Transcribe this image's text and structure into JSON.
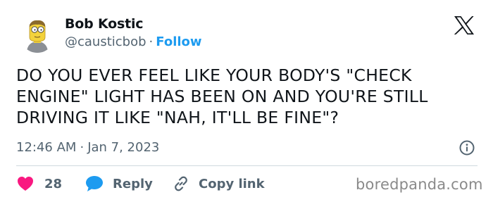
{
  "author": {
    "name": "Bob Kostic",
    "handle": "@causticbob",
    "separator": "·",
    "follow_label": "Follow"
  },
  "tweet": {
    "text": "DO YOU EVER FEEL LIKE YOUR BODY'S \"CHECK ENGINE\" LIGHT HAS BEEN ON AND YOU'RE STILL DRIVING IT LIKE \"NAH, IT'LL BE FINE\"?",
    "time": "12:46 AM",
    "separator": "·",
    "date": "Jan 7, 2023"
  },
  "actions": {
    "like_count": "28",
    "reply_label": "Reply",
    "copy_label": "Copy link"
  },
  "icons": {
    "brand": "x-logo-icon",
    "info": "info-icon",
    "like": "heart-icon",
    "reply": "speech-bubble-icon",
    "copy": "link-icon"
  },
  "colors": {
    "accent": "#1d9bf0",
    "like": "#f91880",
    "text": "#0f1419",
    "muted": "#536471"
  },
  "watermark": "boredpanda.com"
}
